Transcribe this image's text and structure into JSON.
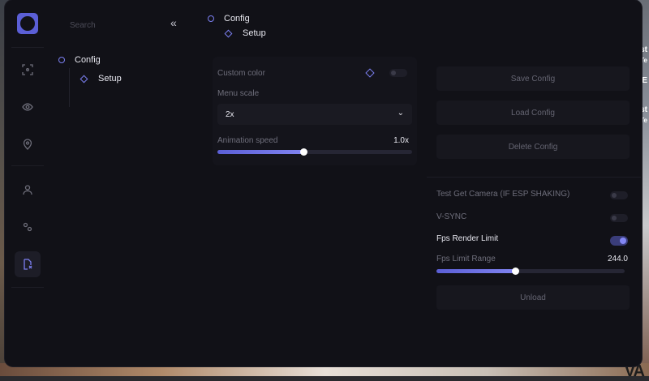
{
  "search": {
    "placeholder": "Search"
  },
  "tree": {
    "items": [
      {
        "label": "Config"
      },
      {
        "label": "Setup"
      }
    ]
  },
  "breadcrumb": {
    "items": [
      {
        "label": "Config"
      },
      {
        "label": "Setup"
      }
    ]
  },
  "left_panel": {
    "custom_color_label": "Custom color",
    "menu_scale_label": "Menu scale",
    "menu_scale_value": "2x",
    "animation_speed_label": "Animation speed",
    "animation_speed_value": "1.0x",
    "animation_speed_fraction": 0.44
  },
  "right_panel": {
    "buttons": {
      "save": "Save Config",
      "load": "Load Config",
      "delete": "Delete Config"
    },
    "options": {
      "test_camera": "Test Get Camera (IF ESP SHAKING)",
      "vsync": "V-SYNC",
      "fps_render_limit": "Fps Render Limit",
      "fps_limit_range": "Fps Limit Range",
      "fps_limit_value": "244.0",
      "fps_limit_fraction": 0.42
    },
    "unload": "Unload"
  },
  "background": {
    "right_text": [
      "st",
      "Te",
      "E",
      "st",
      "Te"
    ],
    "bottom_text": "VA"
  },
  "colors": {
    "accent": "#7b7ff0",
    "window_bg": "#111117",
    "panel_bg": "#14141b"
  }
}
